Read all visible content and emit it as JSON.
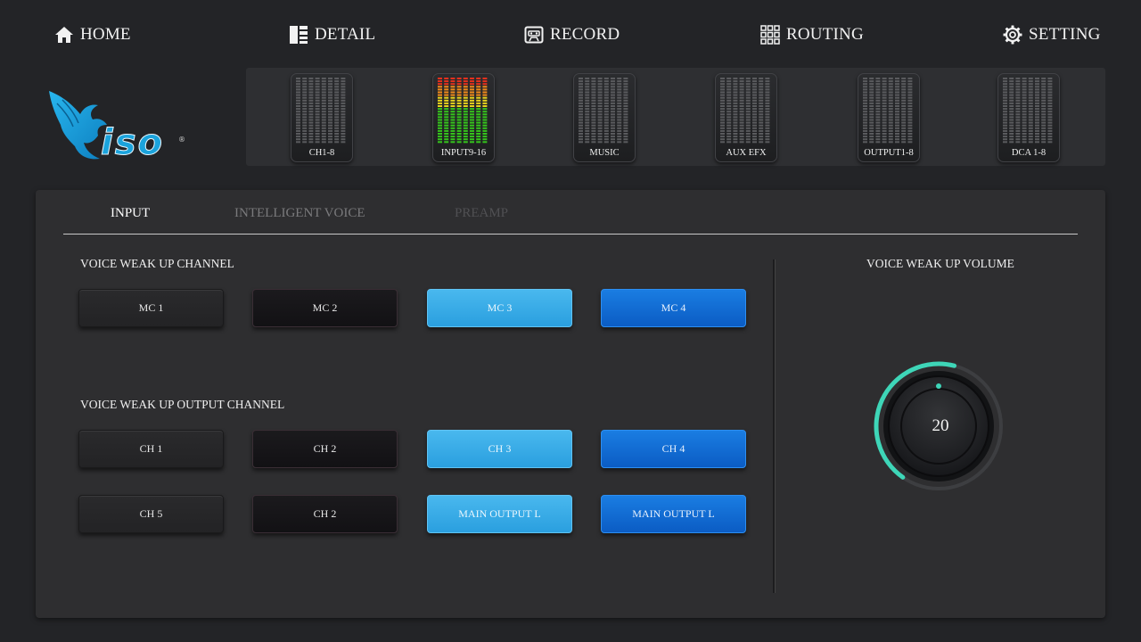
{
  "nav": {
    "home": "HOME",
    "detail": "DETAIL",
    "record": "RECORD",
    "routing": "ROUTING",
    "setting": "SETTING"
  },
  "brand": {
    "logo_text": "iso",
    "trademark": "®"
  },
  "meters": [
    {
      "label": "CH1-8",
      "active": false
    },
    {
      "label": "INPUT9-16",
      "active": true
    },
    {
      "label": "MUSIC",
      "active": false
    },
    {
      "label": "AUX EFX",
      "active": false
    },
    {
      "label": "OUTPUT1-8",
      "active": false
    },
    {
      "label": "DCA 1-8",
      "active": false
    }
  ],
  "tabs": {
    "input": "INPUT",
    "intelligent_voice": "INTELLIGENT VOICE",
    "preamp": "PREAMP"
  },
  "sections": {
    "wakeup_channel": "VOICE WEAK UP CHANNEL",
    "wakeup_output": "VOICE WEAK UP OUTPUT CHANNEL",
    "wakeup_volume": "VOICE WEAK UP VOLUME"
  },
  "mc_buttons": [
    "MC 1",
    "MC 2",
    "MC  3",
    "MC 4"
  ],
  "output_row1": [
    "CH 1",
    "CH 2",
    "CH 3",
    "CH 4"
  ],
  "output_row2": [
    "CH 5",
    "CH 2",
    "MAIN OUTPUT L",
    "MAIN OUTPUT L"
  ],
  "volume": {
    "value": "20",
    "level": 0.55
  },
  "colors": {
    "accent_teal": "#3ed6b8",
    "light_blue": "#2a9fdf",
    "dark_blue": "#0b5cc4",
    "logo_blue": "#1ba3dc"
  }
}
